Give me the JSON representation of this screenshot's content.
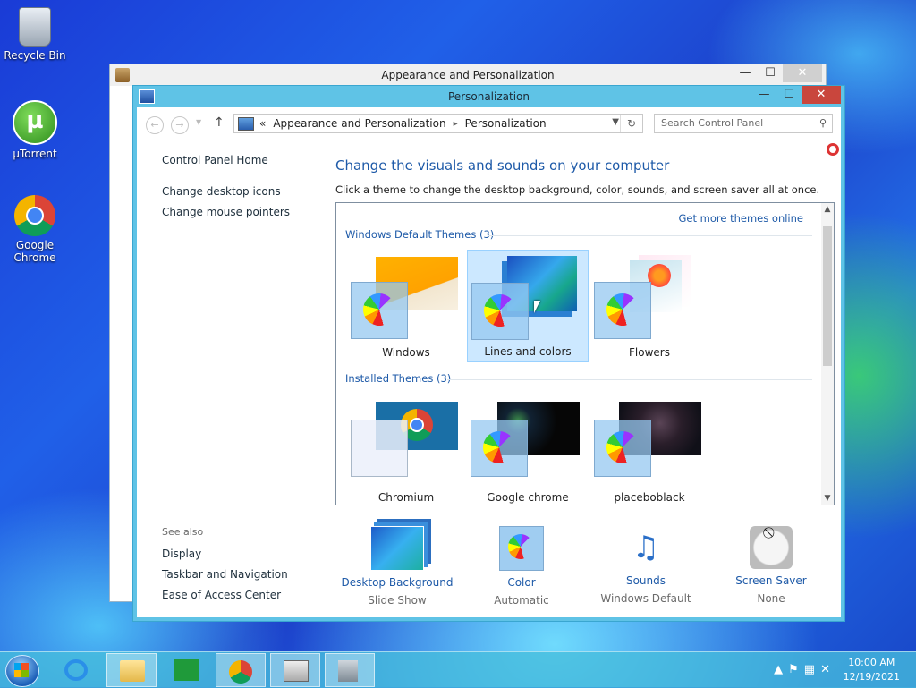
{
  "desktop": {
    "icons": [
      {
        "label": "Recycle Bin"
      },
      {
        "label": "µTorrent"
      },
      {
        "label": "Google Chrome"
      }
    ]
  },
  "back_window": {
    "title": "Appearance and Personalization"
  },
  "window": {
    "title": "Personalization",
    "controls": {
      "minimize": "—",
      "maximize": "☐",
      "close": "✕"
    },
    "address": {
      "prefix": "«",
      "crumbs": [
        "Appearance and Personalization",
        "Personalization"
      ]
    },
    "search": {
      "placeholder": "Search Control Panel"
    },
    "left_pane": {
      "home": "Control Panel Home",
      "links": [
        "Change desktop icons",
        "Change mouse pointers"
      ],
      "see_also_label": "See also",
      "see_also": [
        "Display",
        "Taskbar and Navigation",
        "Ease of Access Center"
      ]
    },
    "heading": "Change the visuals and sounds on your computer",
    "subheading": "Click a theme to change the desktop background, color, sounds, and screen saver all at once.",
    "get_more": "Get more themes online",
    "groups": [
      {
        "title": "Windows Default Themes (3)",
        "themes": [
          "Windows",
          "Lines and colors",
          "Flowers"
        ],
        "selected": "Lines and colors"
      },
      {
        "title": "Installed Themes (3)",
        "themes": [
          "Chromium",
          "Google chrome",
          "placeboblack"
        ]
      }
    ],
    "bottom": [
      {
        "title": "Desktop Background",
        "value": "Slide Show",
        "icon": "desktop-background-icon"
      },
      {
        "title": "Color",
        "value": "Automatic",
        "icon": "color-icon"
      },
      {
        "title": "Sounds",
        "value": "Windows Default",
        "icon": "sounds-icon"
      },
      {
        "title": "Screen Saver",
        "value": "None",
        "icon": "screen-saver-icon"
      }
    ]
  },
  "taskbar": {
    "clock": {
      "time": "10:00 AM",
      "date": "12/19/2021"
    }
  }
}
